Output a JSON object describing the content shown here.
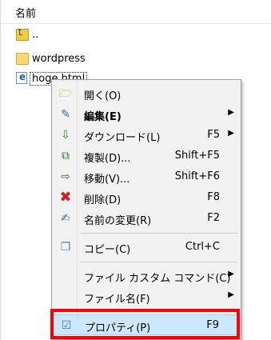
{
  "header": {
    "column_name": "名前"
  },
  "files": [
    {
      "name": "..",
      "icon": "parent-folder-icon"
    },
    {
      "name": "wordpress",
      "icon": "folder-icon"
    },
    {
      "name": "hoge.html",
      "icon": "html-file-icon"
    }
  ],
  "menu": {
    "items": [
      {
        "label": "開く(O)",
        "shortcut": "",
        "icon": "open-folder-icon",
        "bold": false,
        "submenu": false
      },
      {
        "label": "編集(E)",
        "shortcut": "",
        "icon": "edit-pencil-icon",
        "bold": true,
        "submenu": true
      },
      {
        "label": "ダウンロード(L)",
        "shortcut": "F5",
        "icon": "download-icon",
        "bold": false,
        "submenu": true
      },
      {
        "label": "複製(D)...",
        "shortcut": "Shift+F5",
        "icon": "duplicate-icon",
        "bold": false,
        "submenu": false
      },
      {
        "label": "移動(V)...",
        "shortcut": "Shift+F6",
        "icon": "move-icon",
        "bold": false,
        "submenu": false
      },
      {
        "label": "削除(D)",
        "shortcut": "F8",
        "icon": "delete-x-icon",
        "bold": false,
        "submenu": false
      },
      {
        "label": "名前の変更(R)",
        "shortcut": "F2",
        "icon": "rename-icon",
        "bold": false,
        "submenu": false
      },
      {
        "label": "コピー(C)",
        "shortcut": "Ctrl+C",
        "icon": "copy-icon",
        "bold": false,
        "submenu": false
      },
      {
        "label": "ファイル カスタム コマンド(C)",
        "shortcut": "",
        "icon": "",
        "bold": false,
        "submenu": true
      },
      {
        "label": "ファイル名(F)",
        "shortcut": "",
        "icon": "",
        "bold": false,
        "submenu": true
      },
      {
        "label": "プロパティ(P)",
        "shortcut": "F9",
        "icon": "properties-icon",
        "bold": false,
        "submenu": false,
        "highlighted": true
      }
    ]
  },
  "colors": {
    "highlight": "#cce8ff",
    "annotation_box": "#ff0000",
    "delete_icon": "#d21f1f"
  }
}
